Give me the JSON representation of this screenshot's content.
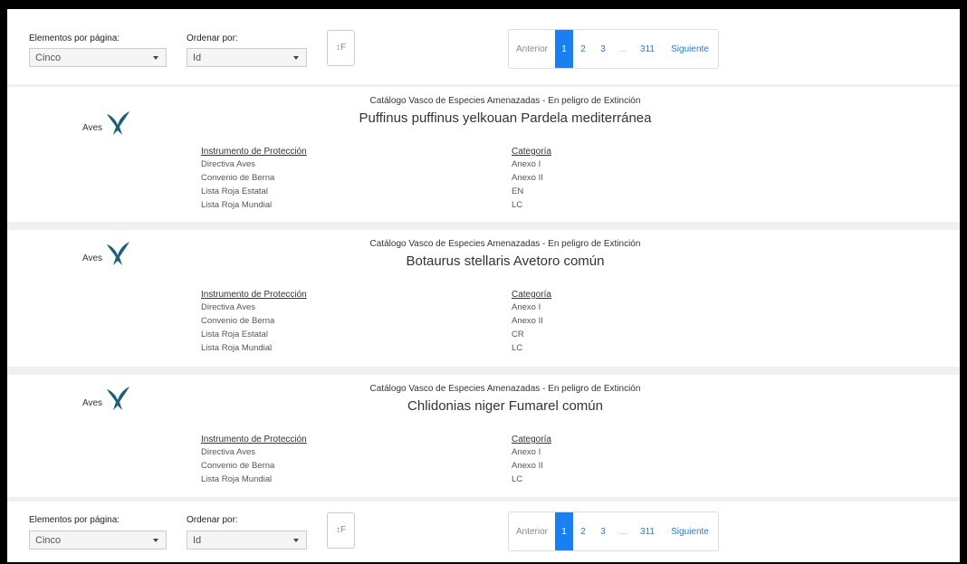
{
  "toolbar_top": {
    "items_per_page_label": "Elementos por página:",
    "items_per_page_value": "Cinco",
    "order_by_label": "Ordenar por:",
    "order_by_value": "Id",
    "sort_icon": "sort-order-icon",
    "sort_glyph": "↕F",
    "pagination": {
      "previous": "Anterior",
      "pages": [
        "1",
        "2",
        "3"
      ],
      "ellipsis": "...",
      "last": "311",
      "next": "Siguiente",
      "active_page": "1"
    }
  },
  "toolbar_bottom": {
    "items_per_page_label": "Elementos por página:",
    "items_per_page_value": "Cinco",
    "order_by_label": "Ordenar por:",
    "order_by_value": "Id",
    "sort_glyph": "↕F",
    "pagination": {
      "previous": "Anterior",
      "pages": [
        "1",
        "2",
        "3"
      ],
      "ellipsis": "...",
      "last": "311",
      "next": "Siguiente",
      "active_page": "1"
    }
  },
  "colors": {
    "accent": "#1a7ff0",
    "bird_icon": "#1e5f7a"
  },
  "cards": [
    {
      "category": "Aves",
      "icon": "bird-icon",
      "catalog": "Catálogo Vasco de Especies Amenazadas - En peligro de Extinción",
      "species": "Puffinus puffinus yelkouan Pardela mediterránea",
      "instrument_header": "Instrumento de Protección",
      "category_header": "Categoría",
      "rows": [
        {
          "instrument": "Directiva Aves",
          "category": "Anexo I"
        },
        {
          "instrument": "Convenio de Berna",
          "category": "Anexo II"
        },
        {
          "instrument": "Lista Roja Estatal",
          "category": "EN"
        },
        {
          "instrument": "Lista Roja Mundial",
          "category": "LC"
        }
      ]
    },
    {
      "category": "Aves",
      "icon": "bird-icon",
      "catalog": "Catálogo Vasco de Especies Amenazadas - En peligro de Extinción",
      "species": "Botaurus stellaris Avetoro común",
      "instrument_header": "Instrumento de Protección",
      "category_header": "Categoría",
      "rows": [
        {
          "instrument": "Directiva Aves",
          "category": "Anexo I"
        },
        {
          "instrument": "Convenio de Berna",
          "category": "Anexo II"
        },
        {
          "instrument": "Lista Roja Estatal",
          "category": "CR"
        },
        {
          "instrument": "Lista Roja Mundial",
          "category": "LC"
        }
      ]
    },
    {
      "category": "Aves",
      "icon": "bird-icon",
      "catalog": "Catálogo Vasco de Especies Amenazadas - En peligro de Extinción",
      "species": "Chlidonias niger Fumarel común",
      "instrument_header": "Instrumento de Protección",
      "category_header": "Categoría",
      "rows": [
        {
          "instrument": "Directiva Aves",
          "category": "Anexo I"
        },
        {
          "instrument": "Convenio de Berna",
          "category": "Anexo II"
        },
        {
          "instrument": "Lista Roja Mundial",
          "category": "LC"
        }
      ]
    }
  ]
}
